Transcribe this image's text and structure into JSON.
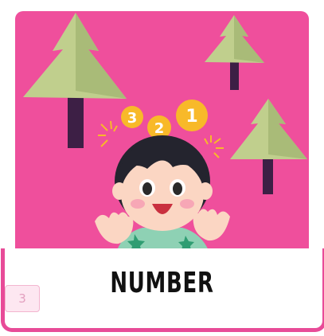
{
  "card": {
    "title": "NUMBER",
    "badge": "3",
    "background_color": "#ef4f9c",
    "accent_border_color": "#e84b98"
  },
  "illustration": {
    "subject": "girl-with-numbers",
    "bubbles": [
      "3",
      "2",
      "1"
    ],
    "bubble_color": "#f8b929",
    "tree_color": "#c0cf8d"
  }
}
